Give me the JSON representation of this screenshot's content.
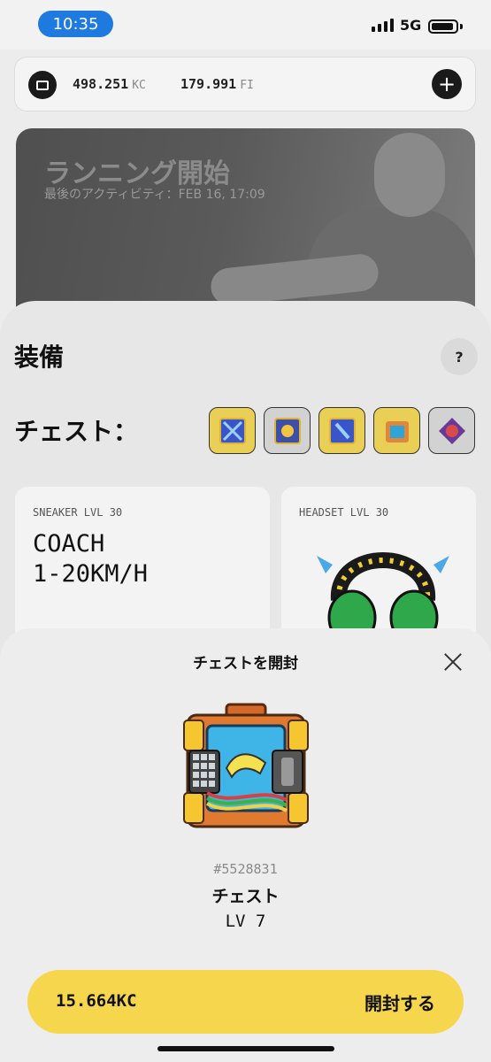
{
  "status_bar": {
    "time": "10:35",
    "network": "5G"
  },
  "wallet": {
    "balances": [
      {
        "amount": "498.251",
        "unit": "KC"
      },
      {
        "amount": "179.991",
        "unit": "FI"
      }
    ],
    "add_icon": "plus-icon"
  },
  "hero": {
    "title": "ランニング開始",
    "subtitle": "最後のアクティビティ：FEB 16, 17:09"
  },
  "equipment": {
    "title": "装備",
    "help_label": "?",
    "chests_label": "チェスト：",
    "cards": [
      {
        "label": "SNEAKER LVL 30",
        "model": "COACH\n1-20KM/H"
      },
      {
        "label": "HEADSET LVL 30"
      }
    ]
  },
  "open_chest_modal": {
    "title": "チェストを開封",
    "chest_id": "#5528831",
    "chest_name": "チェスト",
    "chest_level": "LV 7",
    "price": "15.664KC",
    "open_label": "開封する"
  },
  "colors": {
    "accent_yellow": "#f5d64c",
    "time_pill": "#1f7ae0"
  }
}
